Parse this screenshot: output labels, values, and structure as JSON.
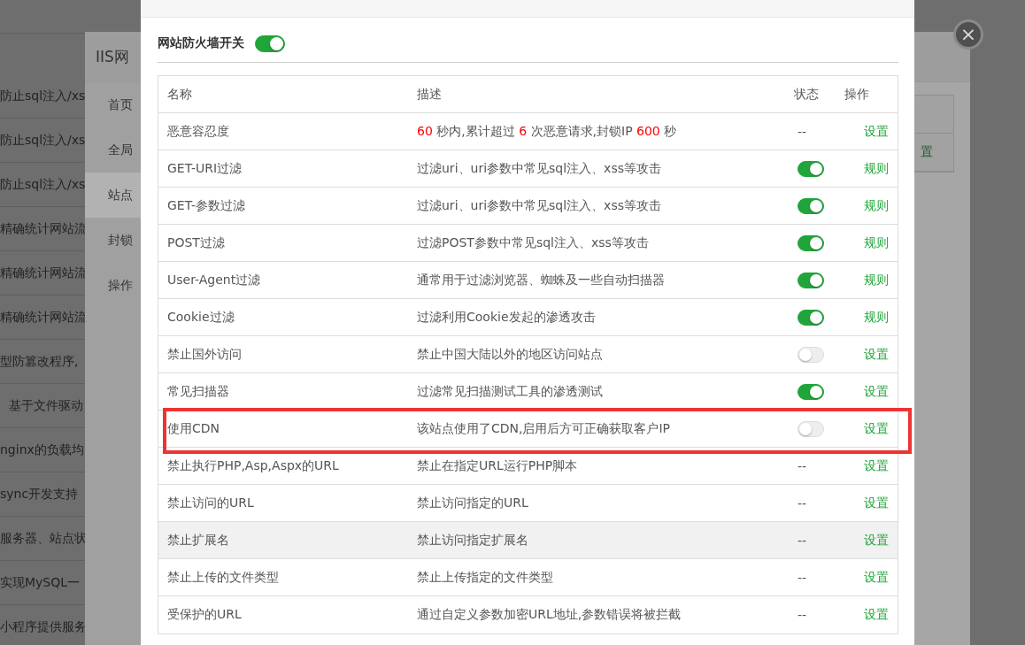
{
  "background_list": {
    "rows": [
      {
        "text": "防止sql注入/xs",
        "indent": false
      },
      {
        "text": "防止sql注入/xs",
        "indent": false
      },
      {
        "text": "防止sql注入/xs",
        "indent": false
      },
      {
        "text": "精确统计网站流",
        "indent": false
      },
      {
        "text": "精确统计网站流",
        "indent": false
      },
      {
        "text": "精确统计网站流",
        "indent": false
      },
      {
        "text": "型防篡改程序,",
        "indent": false
      },
      {
        "text": "基于文件驱动",
        "indent": true
      },
      {
        "text": "nginx的负载均",
        "indent": false
      },
      {
        "text": "sync开发支持",
        "indent": false
      },
      {
        "text": "服务器、站点状",
        "indent": false
      },
      {
        "text": "实现MySQL一",
        "indent": false
      },
      {
        "text": "小程序提供服务",
        "indent": false
      }
    ]
  },
  "back_dialog": {
    "title": "IIS网",
    "menu": [
      {
        "label": "首页",
        "selected": false
      },
      {
        "label": "全局",
        "selected": false
      },
      {
        "label": "站点",
        "selected": true
      },
      {
        "label": "封锁",
        "selected": false
      },
      {
        "label": "操作",
        "selected": false
      }
    ],
    "table_fragment": [
      "置"
    ]
  },
  "close_button": {
    "symbol": "×"
  },
  "dialog": {
    "switch": {
      "label": "网站防火墙开关",
      "on": true
    },
    "table": {
      "columns": [
        "名称",
        "描述",
        "状态",
        "操作"
      ],
      "rows": [
        {
          "name": "恶意容忍度",
          "description_parts": [
            {
              "text": "60",
              "kind": "number"
            },
            {
              "text": " 秒内,累计超过 ",
              "kind": "plain"
            },
            {
              "text": "6",
              "kind": "number"
            },
            {
              "text": " 次恶意请求,封锁IP ",
              "kind": "plain"
            },
            {
              "text": "600",
              "kind": "number"
            },
            {
              "text": " 秒",
              "kind": "plain"
            }
          ],
          "status": {
            "kind": "text",
            "text": "--"
          },
          "action": "设置",
          "hovered": false,
          "highlighted": false
        },
        {
          "name": "GET-URI过滤",
          "description": "过滤uri、uri参数中常见sql注入、xss等攻击",
          "status": {
            "kind": "toggle",
            "on": true
          },
          "action": "规则",
          "hovered": false,
          "highlighted": false
        },
        {
          "name": "GET-参数过滤",
          "description": "过滤uri、uri参数中常见sql注入、xss等攻击",
          "status": {
            "kind": "toggle",
            "on": true
          },
          "action": "规则",
          "hovered": false,
          "highlighted": false
        },
        {
          "name": "POST过滤",
          "description": "过滤POST参数中常见sql注入、xss等攻击",
          "status": {
            "kind": "toggle",
            "on": true
          },
          "action": "规则",
          "hovered": false,
          "highlighted": false
        },
        {
          "name": "User-Agent过滤",
          "description": "通常用于过滤浏览器、蜘蛛及一些自动扫描器",
          "status": {
            "kind": "toggle",
            "on": true
          },
          "action": "规则",
          "hovered": false,
          "highlighted": false
        },
        {
          "name": "Cookie过滤",
          "description": "过滤利用Cookie发起的渗透攻击",
          "status": {
            "kind": "toggle",
            "on": true
          },
          "action": "规则",
          "hovered": false,
          "highlighted": false
        },
        {
          "name": "禁止国外访问",
          "description": "禁止中国大陆以外的地区访问站点",
          "status": {
            "kind": "toggle",
            "on": false
          },
          "action": "设置",
          "hovered": false,
          "highlighted": false
        },
        {
          "name": "常见扫描器",
          "description": "过滤常见扫描测试工具的渗透测试",
          "status": {
            "kind": "toggle",
            "on": true
          },
          "action": "设置",
          "hovered": false,
          "highlighted": false
        },
        {
          "name": "使用CDN",
          "description": "该站点使用了CDN,启用后方可正确获取客户IP",
          "status": {
            "kind": "toggle",
            "on": false
          },
          "action": "设置",
          "hovered": false,
          "highlighted": true
        },
        {
          "name": "禁止执行PHP,Asp,Aspx的URL",
          "description": "禁止在指定URL运行PHP脚本",
          "status": {
            "kind": "text",
            "text": "--"
          },
          "action": "设置",
          "hovered": false,
          "highlighted": false
        },
        {
          "name": "禁止访问的URL",
          "description": "禁止访问指定的URL",
          "status": {
            "kind": "text",
            "text": "--"
          },
          "action": "设置",
          "hovered": false,
          "highlighted": false
        },
        {
          "name": "禁止扩展名",
          "description": "禁止访问指定扩展名",
          "status": {
            "kind": "text",
            "text": "--"
          },
          "action": "设置",
          "hovered": true,
          "highlighted": false
        },
        {
          "name": "禁止上传的文件类型",
          "description": "禁止上传指定的文件类型",
          "status": {
            "kind": "text",
            "text": "--"
          },
          "action": "设置",
          "hovered": false,
          "highlighted": false
        },
        {
          "name": "受保护的URL",
          "description": "通过自定义参数加密URL地址,参数错误将被拦截",
          "status": {
            "kind": "text",
            "text": "--"
          },
          "action": "设置",
          "hovered": false,
          "highlighted": false
        }
      ]
    }
  }
}
